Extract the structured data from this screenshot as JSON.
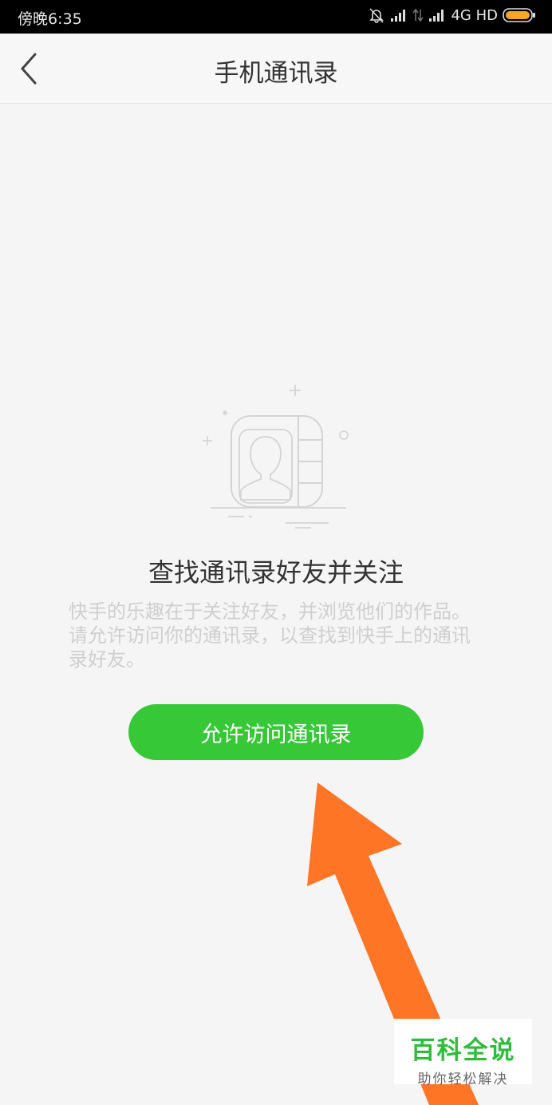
{
  "status_bar": {
    "time": "傍晚6:35",
    "network": "4G HD",
    "icons": [
      "bell-off-icon",
      "signal-icon",
      "data-arrows-icon",
      "signal-icon",
      "battery-icon"
    ],
    "battery_color": "#f5a623"
  },
  "nav": {
    "title": "手机通讯录",
    "back_icon": "chevron-left-icon"
  },
  "content": {
    "illustration_icon": "contact-book-icon",
    "heading": "查找通讯录好友并关注",
    "description": "快手的乐趣在于关注好友，并浏览他们的作品。请允许访问你的通讯录，以查找到快手上的通讯录好友。",
    "allow_button_label": "允许访问通讯录"
  },
  "overlay": {
    "arrow_icon": "pointer-arrow-icon",
    "arrow_color": "#ff7526"
  },
  "watermark": {
    "title": "百科全说",
    "subtitle": "助你轻松解决"
  },
  "colors": {
    "accent": "#37c837",
    "background": "#f5f5f5"
  }
}
